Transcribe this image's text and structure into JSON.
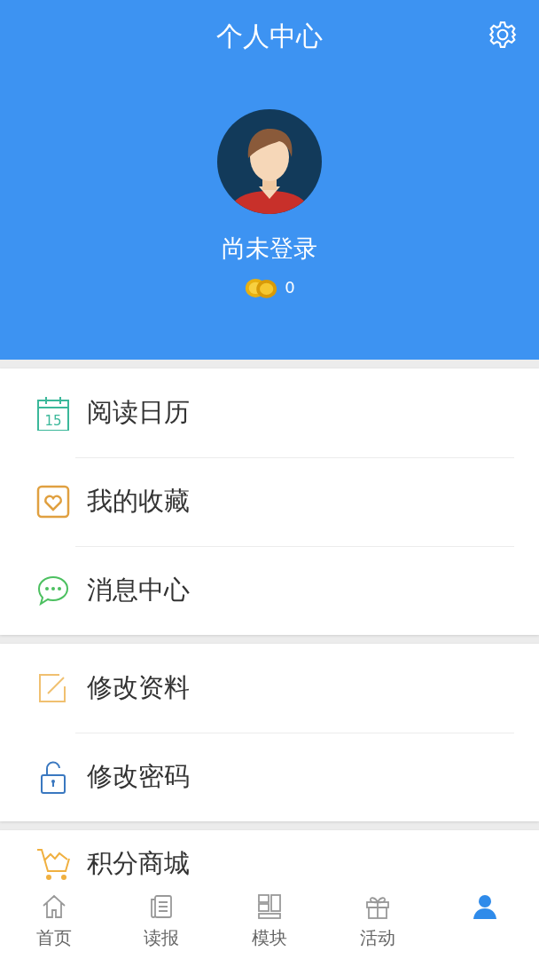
{
  "header": {
    "title": "个人中心",
    "user_name": "尚未登录",
    "coins": "0"
  },
  "menu_groups": [
    {
      "items": [
        {
          "kind": "calendar",
          "label": "阅读日历",
          "icon_text": "15",
          "color": "#3bb89a"
        },
        {
          "kind": "heart",
          "label": "我的收藏",
          "color": "#e0a040"
        },
        {
          "kind": "chat",
          "label": "消息中心",
          "color": "#4cc060"
        }
      ]
    },
    {
      "items": [
        {
          "kind": "edit",
          "label": "修改资料",
          "color": "#f0c070"
        },
        {
          "kind": "lock",
          "label": "修改密码",
          "color": "#3a78c0"
        }
      ]
    },
    {
      "items": [
        {
          "kind": "cart",
          "label": "积分商城",
          "color": "#f0b040"
        }
      ]
    }
  ],
  "tabs": [
    {
      "kind": "home",
      "label": "首页",
      "selected": false
    },
    {
      "kind": "paper",
      "label": "读报",
      "selected": false
    },
    {
      "kind": "blocks",
      "label": "模块",
      "selected": false
    },
    {
      "kind": "gift",
      "label": "活动",
      "selected": false
    },
    {
      "kind": "person",
      "selected": true
    }
  ]
}
